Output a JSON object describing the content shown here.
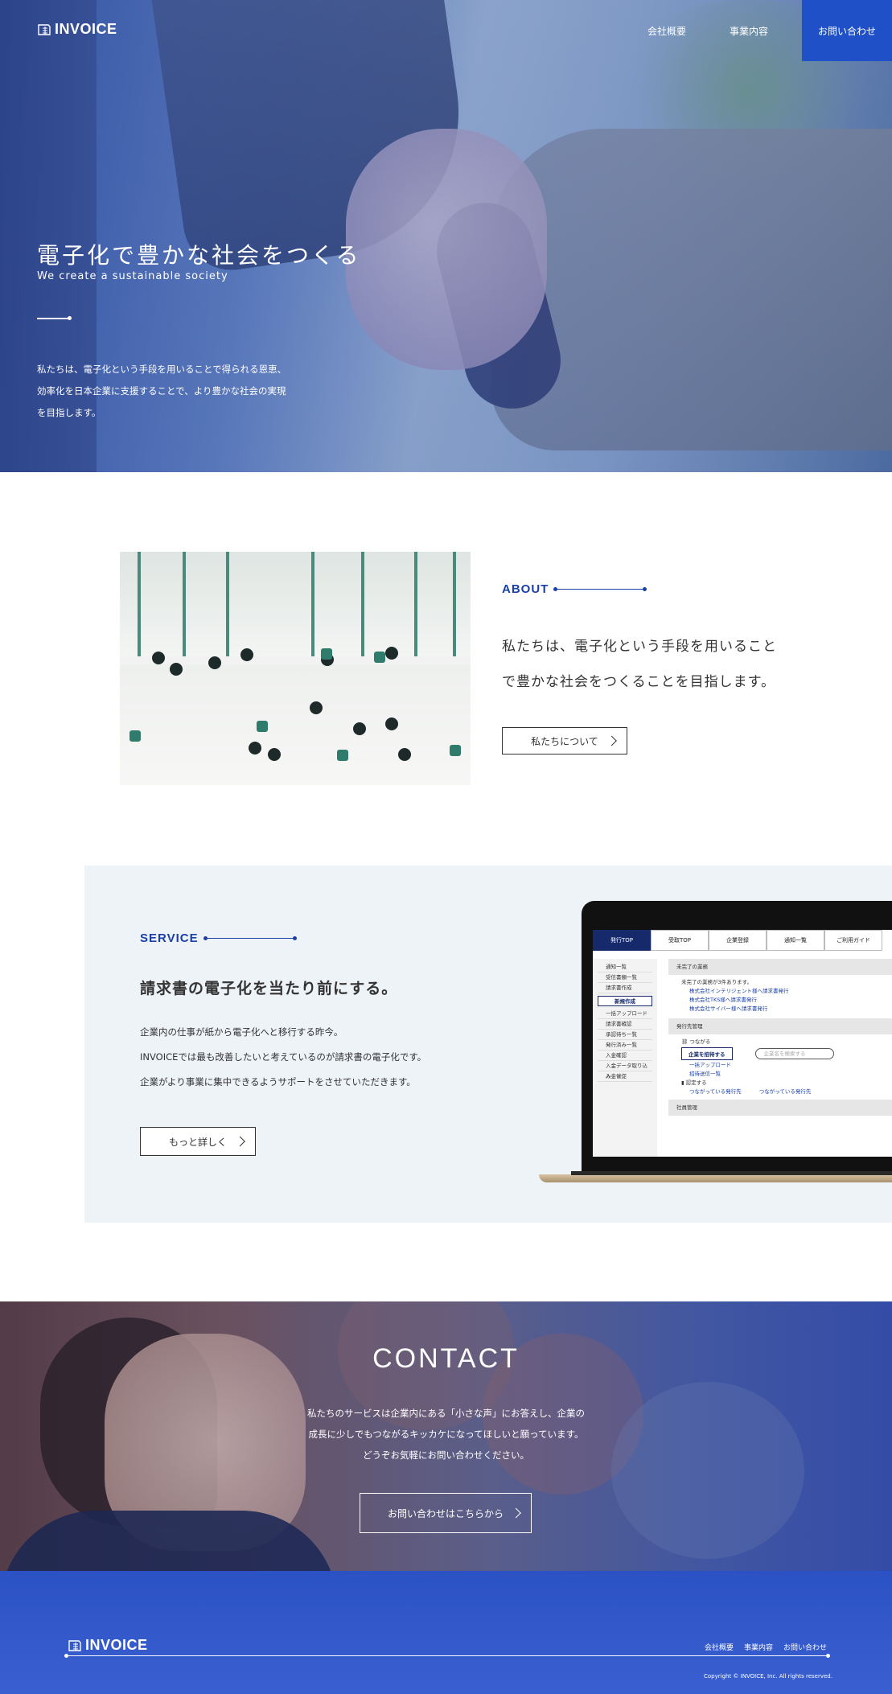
{
  "brand": {
    "logo_text": "INVOICE"
  },
  "nav": {
    "items": [
      "会社概要",
      "事業内容"
    ],
    "contact_tab": "お問い合わせ"
  },
  "hero": {
    "title": "電子化で豊かな社会をつくる",
    "subtitle": "We create a sustainable society",
    "body": [
      "私たちは、電子化という手段を用いることで得られる恩恵、",
      "効率化を日本企業に支援することで、より豊かな社会の実現",
      "を目指します。"
    ]
  },
  "about": {
    "label": "ABOUT",
    "text": [
      "私たちは、電子化という手段を用いること",
      "で豊かな社会をつくることを目指します。"
    ],
    "button": "私たちについて"
  },
  "service": {
    "label": "SERVICE",
    "title": "請求書の電子化を当たり前にする。",
    "body": [
      "企業内の仕事が紙から電子化へと移行する昨今。",
      "INVOICEでは最も改善したいと考えているのが請求書の電子化です。",
      "企業がより事業に集中できるようサポートをさせていただきます。"
    ],
    "button": "もっと詳しく",
    "screen": {
      "tabs": [
        "発行TOP",
        "受取TOP",
        "企業登録",
        "通知一覧",
        "ご利用ガイド"
      ],
      "sidebar": [
        "通知一覧",
        "受信書類一覧",
        "請求書作成",
        "新規作成",
        "一括アップロード",
        "請求書確認",
        "承認待ち一覧",
        "発行済み一覧",
        "入金確認",
        "入金データ取り込み",
        "入金催促"
      ],
      "sections": {
        "unfinished": "未完了の業務",
        "count_text": "未完了の業務が3件あります。",
        "links": [
          "株式会社インテリジェント様へ請求書発行",
          "株式会社TKS様へ請求書発行",
          "株式会社サイバー様へ請求書発行"
        ],
        "issuer": "発行先管理",
        "connect": "つながる",
        "invite_button": "企業を招待する",
        "search_placeholder": "企業名を検索する",
        "bulk_upload": "一括アップロード",
        "invite_list": "招待送信一覧",
        "verify": "認定する",
        "connected_a": "つながっている発行先",
        "connected_b": "つながっている発行先",
        "company": "社員管理"
      }
    }
  },
  "contact": {
    "title": "CONTACT",
    "body": [
      "私たちのサービスは企業内にある「小さな声」にお答えし、企業の",
      "成長に少しでもつながるキッカケになってほしいと願っています。",
      "どうぞお気軽にお問い合わせください。"
    ],
    "button": "お問い合わせはこちらから"
  },
  "footer": {
    "nav": [
      "会社概要",
      "事業内容",
      "お問い合わせ"
    ],
    "copyright": "Copyright © INVOICE, Inc. All rights reserved."
  },
  "colors": {
    "accent": "#1a3fa6",
    "contact_tab": "#1f50c8",
    "footer": "#2b52c4",
    "service_bg": "#eef3f8"
  }
}
